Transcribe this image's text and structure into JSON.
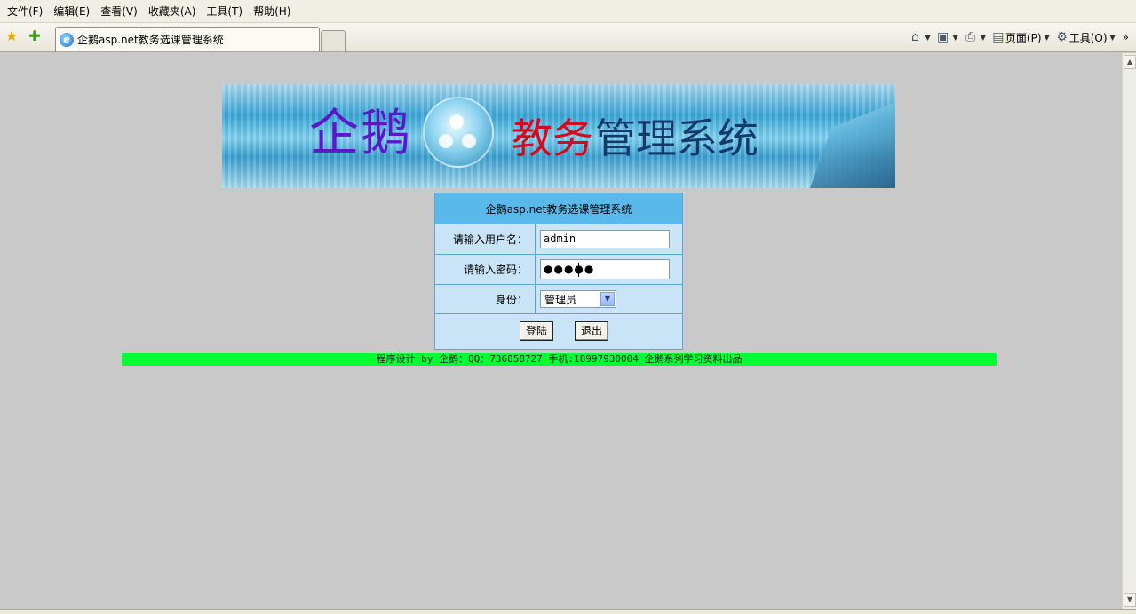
{
  "menubar": {
    "items": [
      "文件(F)",
      "编辑(E)",
      "查看(V)",
      "收藏夹(A)",
      "工具(T)",
      "帮助(H)"
    ]
  },
  "tabs": {
    "active_title": "企鹅asp.net教务选课管理系统"
  },
  "commandbar": {
    "page_label": "页面(P)",
    "tools_label": "工具(O)",
    "more": "»"
  },
  "banner": {
    "brand": "企鹅",
    "title_red": "教务",
    "title_dark": "管理系统"
  },
  "login": {
    "header": "企鹅asp.net教务选课管理系统",
    "username_label": "请输入用户名：",
    "username_value": "admin",
    "password_label": "请输入密码：",
    "password_masked": "●●●●●",
    "role_label": "身份：",
    "role_selected": "管理员",
    "login_button": "登陆",
    "exit_button": "退出"
  },
  "footer": {
    "text": "程序设计 by 企鹅：QQ：736858727 手机:18997930004 企鹅系列学习资料出品"
  },
  "colors": {
    "footer_bg": "#00ff33",
    "login_header_bg": "#58b9ea",
    "login_bg": "#c9e4f7",
    "brand_purple": "#5a18c8",
    "title_red": "#d40b1c",
    "title_dark": "#123a6e"
  }
}
